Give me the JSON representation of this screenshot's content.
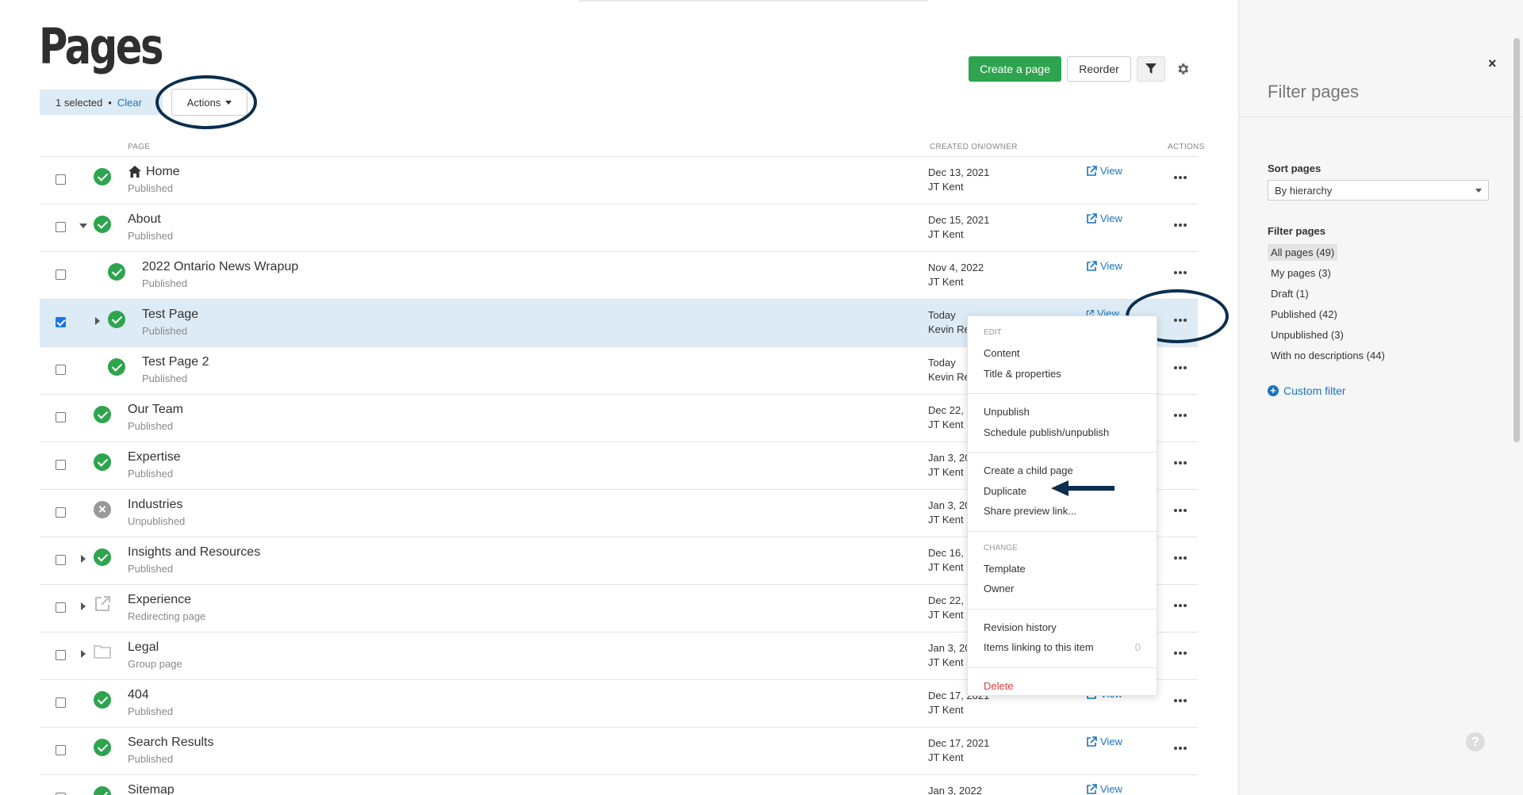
{
  "header": {
    "title": "Pages",
    "selected_text": "1 selected",
    "dot": "•",
    "clear_label": "Clear",
    "actions_label": "Actions",
    "create_label": "Create a page",
    "reorder_label": "Reorder",
    "filter_icon": "filter-icon",
    "settings_icon": "gear-icon"
  },
  "columns": {
    "page": "PAGE",
    "created": "CREATED ON/OWNER",
    "actions": "ACTIONS"
  },
  "rows": [
    {
      "title": "Home",
      "status": "Published",
      "date": "Dec 13, 2021",
      "owner": "JT Kent",
      "view": "View"
    },
    {
      "title": "About",
      "status": "Published",
      "date": "Dec 15, 2021",
      "owner": "JT Kent",
      "view": "View"
    },
    {
      "title": "2022 Ontario News Wrapup",
      "status": "Published",
      "date": "Nov 4, 2022",
      "owner": "JT Kent",
      "view": "View"
    },
    {
      "title": "Test Page",
      "status": "Published",
      "date": "Today",
      "owner": "Kevin Re",
      "view": "View"
    },
    {
      "title": "Test Page 2",
      "status": "Published",
      "date": "Today",
      "owner": "Kevin Re",
      "view": ""
    },
    {
      "title": "Our Team",
      "status": "Published",
      "date": "Dec 22, 2",
      "owner": "JT Kent",
      "view": ""
    },
    {
      "title": "Expertise",
      "status": "Published",
      "date": "Jan 3, 20",
      "owner": "JT Kent",
      "view": ""
    },
    {
      "title": "Industries",
      "status": "Unpublished",
      "date": "Jan 3, 20",
      "owner": "JT Kent",
      "view": ""
    },
    {
      "title": "Insights and Resources",
      "status": "Published",
      "date": "Dec 16, ",
      "owner": "JT Kent",
      "view": ""
    },
    {
      "title": "Experience",
      "status": "Redirecting page",
      "date": "Dec 22, ",
      "owner": "JT Kent",
      "view": ""
    },
    {
      "title": "Legal",
      "status": "Group page",
      "date": "Jan 3, 20",
      "owner": "JT Kent",
      "view": ""
    },
    {
      "title": "404",
      "status": "Published",
      "date": "Dec 17, 2021",
      "owner": "JT Kent",
      "view": "View"
    },
    {
      "title": "Search Results",
      "status": "Published",
      "date": "Dec 17, 2021",
      "owner": "JT Kent",
      "view": "View"
    },
    {
      "title": "Sitemap",
      "status": "",
      "date": "Jan 3, 2022",
      "owner": "",
      "view": "View"
    }
  ],
  "menu": {
    "edit_head": "EDIT",
    "content": "Content",
    "title_props": "Title & properties",
    "unpublish": "Unpublish",
    "schedule": "Schedule publish/unpublish",
    "create_child": "Create a child page",
    "duplicate": "Duplicate",
    "share_preview": "Share preview link...",
    "change_head": "CHANGE",
    "template": "Template",
    "owner": "Owner",
    "revision": "Revision history",
    "linking": "Items linking to this item",
    "linking_count": "0",
    "delete": "Delete"
  },
  "sidebar": {
    "close": "×",
    "title": "Filter pages",
    "sort_label": "Sort pages",
    "sort_value": "By hierarchy",
    "filter_label": "Filter pages",
    "options": [
      "All pages (49)",
      "My pages (3)",
      "Draft (1)",
      "Published (42)",
      "Unpublished (3)",
      "With no descriptions (44)"
    ],
    "custom_filter": "Custom filter",
    "help": "?"
  },
  "colors": {
    "accent_green": "#2ea44f",
    "link_blue": "#1a73c2",
    "selection_blue": "#dcebf5",
    "annotation_navy": "#0b2e4e",
    "danger": "#e03c3c"
  }
}
